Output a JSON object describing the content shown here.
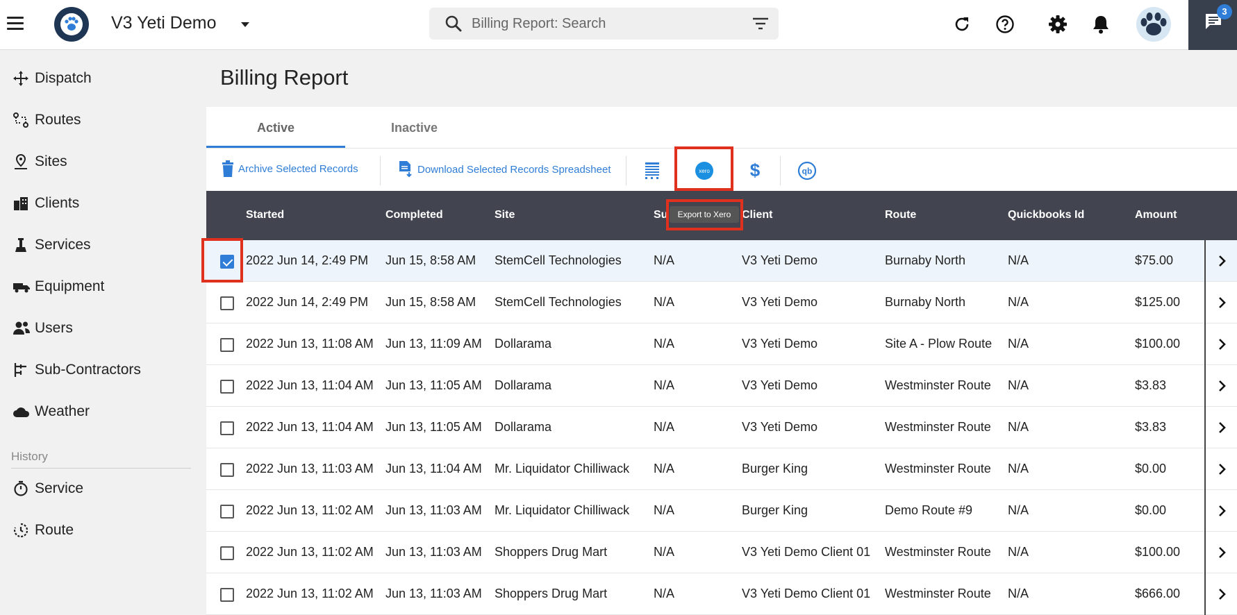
{
  "header": {
    "app_title": "V3 Yeti Demo",
    "search_placeholder": "Billing Report: Search",
    "notification_count": "3"
  },
  "sidebar": {
    "items": [
      {
        "label": "Dispatch",
        "icon": "move-icon"
      },
      {
        "label": "Routes",
        "icon": "route-icon"
      },
      {
        "label": "Sites",
        "icon": "site-pin-icon"
      },
      {
        "label": "Clients",
        "icon": "building-icon"
      },
      {
        "label": "Services",
        "icon": "services-icon"
      },
      {
        "label": "Equipment",
        "icon": "truck-icon"
      },
      {
        "label": "Users",
        "icon": "users-icon"
      },
      {
        "label": "Sub-Contractors",
        "icon": "subcontractor-icon"
      },
      {
        "label": "Weather",
        "icon": "cloud-icon"
      }
    ],
    "history_label": "History",
    "history_items": [
      {
        "label": "Service",
        "icon": "timer-icon"
      },
      {
        "label": "Route",
        "icon": "history-icon"
      }
    ]
  },
  "main": {
    "title": "Billing Report",
    "tabs": [
      {
        "label": "Active",
        "active": true
      },
      {
        "label": "Inactive",
        "active": false
      }
    ],
    "toolbar": {
      "archive_label": "Archive Selected Records",
      "download_label": "Download Selected Records Spreadsheet",
      "tooltip": "Export to Xero"
    },
    "columns": [
      "Started",
      "Completed",
      "Site",
      "Su",
      "Client",
      "Route",
      "Quickbooks Id",
      "Amount"
    ],
    "rows": [
      {
        "started": "2022 Jun 14, 2:49 PM",
        "completed": "Jun 15, 8:58 AM",
        "site": "StemCell Technologies",
        "sub": "N/A",
        "client": "V3 Yeti Demo",
        "route": "Burnaby North",
        "qb": "N/A",
        "amount": "$75.00",
        "checked": true
      },
      {
        "started": "2022 Jun 14, 2:49 PM",
        "completed": "Jun 15, 8:58 AM",
        "site": "StemCell Technologies",
        "sub": "N/A",
        "client": "V3 Yeti Demo",
        "route": "Burnaby North",
        "qb": "N/A",
        "amount": "$125.00",
        "checked": false
      },
      {
        "started": "2022 Jun 13, 11:08 AM",
        "completed": "Jun 13, 11:09 AM",
        "site": "Dollarama",
        "sub": "N/A",
        "client": "V3 Yeti Demo",
        "route": "Site A - Plow Route",
        "qb": "N/A",
        "amount": "$100.00",
        "checked": false
      },
      {
        "started": "2022 Jun 13, 11:04 AM",
        "completed": "Jun 13, 11:05 AM",
        "site": "Dollarama",
        "sub": "N/A",
        "client": "V3 Yeti Demo",
        "route": "Westminster Route",
        "qb": "N/A",
        "amount": "$3.83",
        "checked": false
      },
      {
        "started": "2022 Jun 13, 11:04 AM",
        "completed": "Jun 13, 11:05 AM",
        "site": "Dollarama",
        "sub": "N/A",
        "client": "V3 Yeti Demo",
        "route": "Westminster Route",
        "qb": "N/A",
        "amount": "$3.83",
        "checked": false
      },
      {
        "started": "2022 Jun 13, 11:03 AM",
        "completed": "Jun 13, 11:04 AM",
        "site": "Mr. Liquidator Chilliwack",
        "sub": "N/A",
        "client": "Burger King",
        "route": "Westminster Route",
        "qb": "N/A",
        "amount": "$0.00",
        "checked": false
      },
      {
        "started": "2022 Jun 13, 11:02 AM",
        "completed": "Jun 13, 11:03 AM",
        "site": "Mr. Liquidator Chilliwack",
        "sub": "N/A",
        "client": "Burger King",
        "route": "Demo Route #9",
        "qb": "N/A",
        "amount": "$0.00",
        "checked": false
      },
      {
        "started": "2022 Jun 13, 11:02 AM",
        "completed": "Jun 13, 11:03 AM",
        "site": "Shoppers Drug Mart",
        "sub": "N/A",
        "client": "V3 Yeti Demo Client 01",
        "route": "Westminster Route",
        "qb": "N/A",
        "amount": "$100.00",
        "checked": false
      },
      {
        "started": "2022 Jun 13, 11:02 AM",
        "completed": "Jun 13, 11:03 AM",
        "site": "Shoppers Drug Mart",
        "sub": "N/A",
        "client": "V3 Yeti Demo Client 01",
        "route": "Westminster Route",
        "qb": "N/A",
        "amount": "$666.00",
        "checked": false
      }
    ]
  },
  "colors": {
    "accent": "#2f7dd6",
    "table_header": "#424550",
    "highlight": "#e0301e"
  }
}
